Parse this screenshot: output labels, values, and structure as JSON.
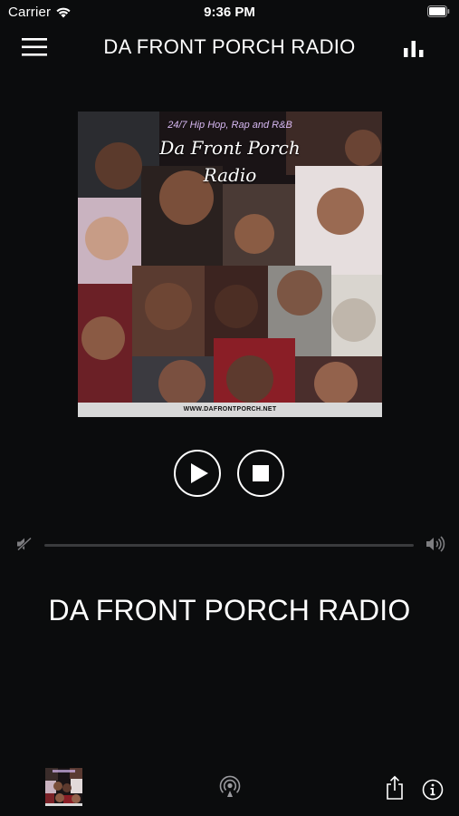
{
  "status_bar": {
    "carrier": "Carrier",
    "time": "9:36 PM"
  },
  "nav": {
    "title": "DA FRONT PORCH RADIO",
    "left_icon": "hamburger-menu-icon",
    "right_icon": "equalizer-bars-icon"
  },
  "artwork": {
    "subtitle": "24/7 Hip Hop, Rap and R&B",
    "title_line1": "Da Front Porch",
    "title_line2": "Radio",
    "url": "WWW.DAFRONTPORCH.NET"
  },
  "controls": {
    "play_icon": "play-icon",
    "stop_icon": "stop-icon"
  },
  "volume": {
    "level": 0,
    "min_icon": "volume-mute-icon",
    "max_icon": "volume-max-icon"
  },
  "now_playing": {
    "station": "DA FRONT PORCH RADIO"
  },
  "bottom_bar": {
    "icons": [
      "station-thumbnail",
      "airplay-icon",
      "share-icon",
      "info-icon"
    ]
  },
  "colors": {
    "background": "#0b0c0d",
    "foreground": "#ffffff",
    "track": "#3a3b3d"
  }
}
